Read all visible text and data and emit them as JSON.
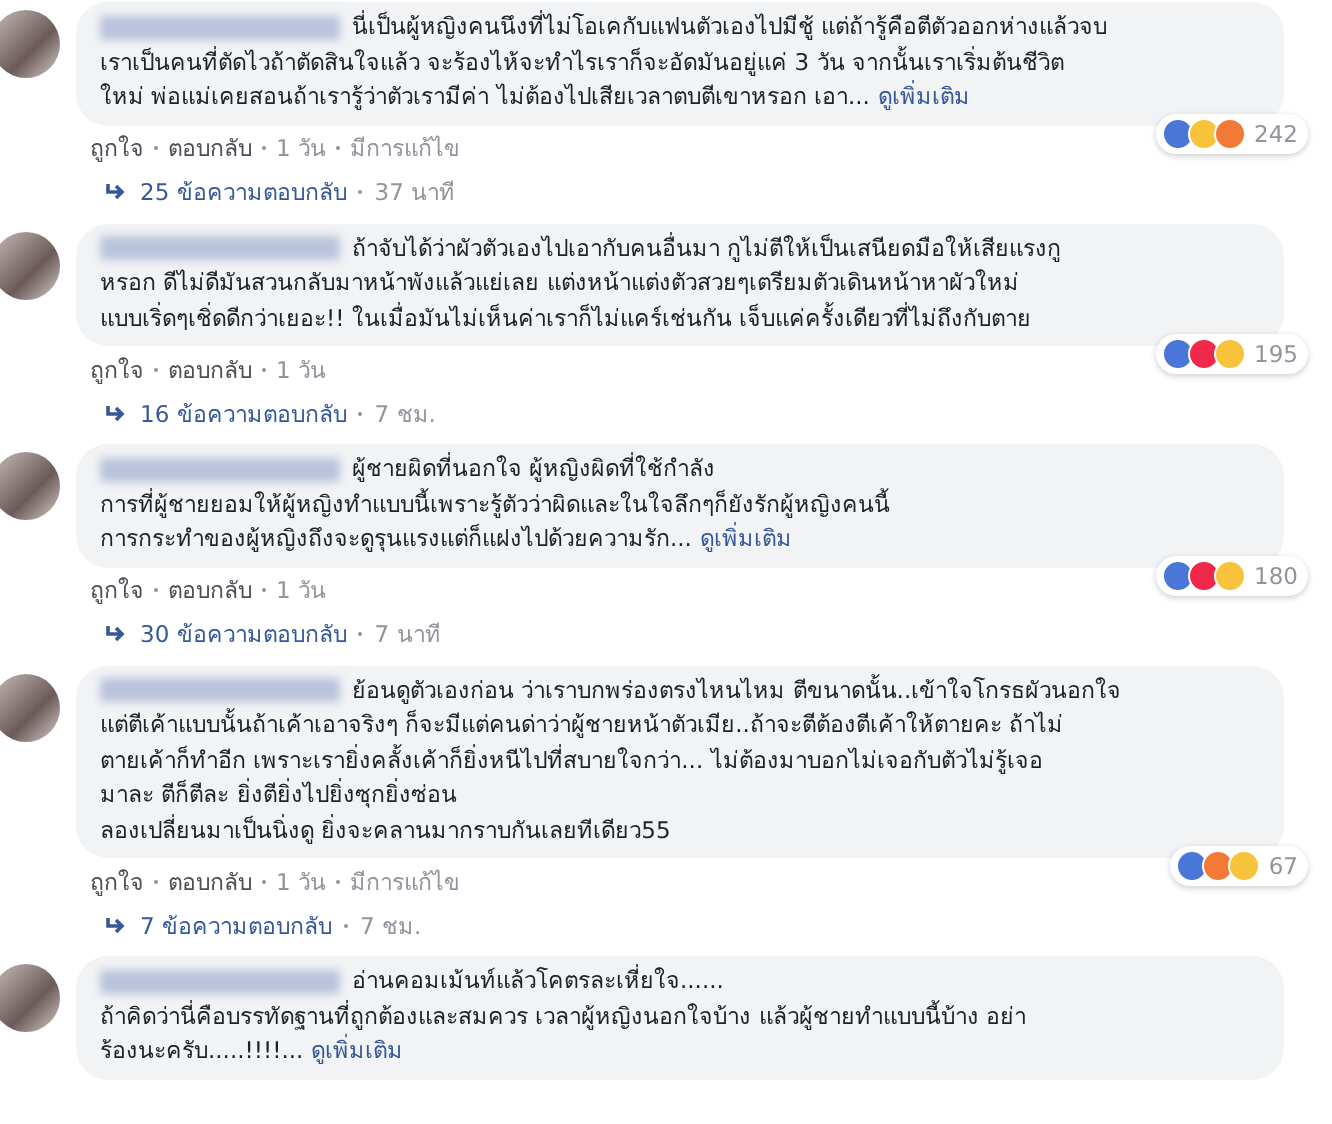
{
  "comments": [
    {
      "lines": [
        "นี่เป็นผู้หญิงคนนึงที่ไม่โอเคกับแฟนตัวเองไปมีชู้ แต่ถ้ารู้คือตีตัวออกห่างแล้วจบ",
        "เราเป็นคนที่ตัดไวถ้าตัดสินใจแล้ว จะร้องไห้จะทำไรเราก็จะอัดมันอยู่แค่ 3 วัน จากนั้นเราเริ่มต้นชีวิต",
        "ใหม่ พ่อแม่เคยสอนถ้าเรารู้ว่าตัวเรามีค่า ไม่ต้องไปเสียเวลาตบตีเขาหรอก เอา..."
      ],
      "see_more": "ดูเพิ่มเติม",
      "reactions": [
        {
          "kind": "like"
        },
        {
          "kind": "sad"
        },
        {
          "kind": "angry"
        }
      ],
      "reaction_count": "242",
      "like": "ถูกใจ",
      "reply": "ตอบกลับ",
      "time": "1 วัน",
      "edited": "มีการแก้ไข",
      "replies": "25 ข้อความตอบกลับ",
      "replies_time": "37 นาที"
    },
    {
      "lines": [
        "ถ้าจับได้ว่าผัวตัวเองไปเอากับคนอื่นมา กูไม่ตีให้เป็นเสนียดมือให้เสียแรงกู",
        "หรอก ดีไม่ดีมันสวนกลับมาหน้าพังแล้วแย่เลย แต่งหน้าแต่งตัวสวยๆเตรียมตัวเดินหน้าหาผัวใหม่",
        "แบบเริ่ดๆเชิ่ดดีกว่าเยอะ!! ในเมื่อมันไม่เห็นค่าเราก็ไม่แคร์เช่นกัน เจ็บแค่ครั้งเดียวที่ไม่ถึงกับตาย"
      ],
      "reactions": [
        {
          "kind": "like"
        },
        {
          "kind": "love"
        },
        {
          "kind": "wow"
        }
      ],
      "reaction_count": "195",
      "like": "ถูกใจ",
      "reply": "ตอบกลับ",
      "time": "1 วัน",
      "replies": "16 ข้อความตอบกลับ",
      "replies_time": "7 ชม."
    },
    {
      "lines": [
        "ผู้ชายผิดที่นอกใจ ผู้หญิงผิดที่ใช้กำลัง",
        "การที่ผู้ชายยอมให้ผู้หญิงทำแบบนี้เพราะรู้ตัวว่าผิดและในใจลึกๆก็ยังรักผู้หญิงคนนี้",
        "การกระทำของผู้หญิงถึงจะดูรุนแรงแต่ก็แฝงไปด้วยความรัก..."
      ],
      "see_more": "ดูเพิ่มเติม",
      "reactions": [
        {
          "kind": "like"
        },
        {
          "kind": "love"
        },
        {
          "kind": "wow"
        }
      ],
      "reaction_count": "180",
      "like": "ถูกใจ",
      "reply": "ตอบกลับ",
      "time": "1 วัน",
      "replies": "30 ข้อความตอบกลับ",
      "replies_time": "7 นาที"
    },
    {
      "lines": [
        "ย้อนดูตัวเองก่อน ว่าเราบกพร่องตรงไหนไหม ตีขนาดนั้น..เข้าใจโกรธผัวนอกใจ",
        "แต่ตีเค้าแบบนั้นถ้าเค้าเอาจริงๆ ก็จะมีแต่คนด่าว่าผู้ชายหน้าตัวเมีย..ถ้าจะตีต้องตีเค้าให้ตายคะ ถ้าไม่",
        "ตายเค้าก็ทำอีก เพราะเรายิ่งคลั้งเค้าก็ยิ่งหนีไปที่สบายใจกว่า... ไม่ต้องมาบอกไม่เจอกับตัวไม่รู้เจอ",
        "มาละ ตีก็ตีละ ยิ่งตียิ่งไปยิ่งซุกยิ่งซ่อน",
        "ลองเปลี่ยนมาเป็นนิ่งดู ยิ่งจะคลานมากราบกันเลยทีเดียว55"
      ],
      "reactions": [
        {
          "kind": "like"
        },
        {
          "kind": "angry"
        },
        {
          "kind": "wow"
        }
      ],
      "reaction_count": "67",
      "like": "ถูกใจ",
      "reply": "ตอบกลับ",
      "time": "1 วัน",
      "edited": "มีการแก้ไข",
      "replies": "7 ข้อความตอบกลับ",
      "replies_time": "7 ชม."
    },
    {
      "lines": [
        "อ่านคอมเม้นท์แล้วโคตรละเหี่ยใจ......",
        "ถ้าคิดว่านี่คือบรรทัดฐานที่ถูกต้องและสมควร เวลาผู้หญิงนอกใจบ้าง แล้วผู้ชายทำแบบนี้บ้าง อย่า",
        "ร้องนะครับ.....!!!!..."
      ],
      "see_more": "ดูเพิ่มเติม"
    }
  ]
}
